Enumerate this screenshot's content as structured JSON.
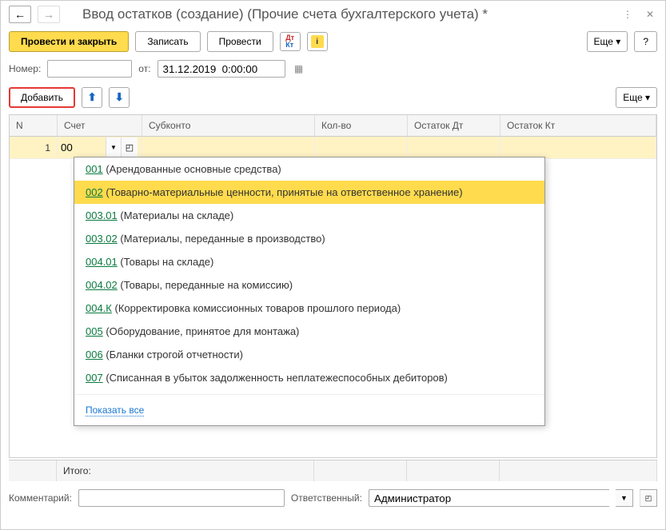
{
  "title": "Ввод остатков (создание) (Прочие счета бухгалтерского учета) *",
  "toolbar": {
    "post_close": "Провести и закрыть",
    "write": "Записать",
    "post": "Провести",
    "more": "Еще",
    "help": "?"
  },
  "form": {
    "number_label": "Номер:",
    "number_value": "",
    "from_label": "от:",
    "date_value": "31.12.2019  0:00:00"
  },
  "actions": {
    "add": "Добавить",
    "more": "Еще"
  },
  "table": {
    "headers": {
      "n": "N",
      "account": "Счет",
      "subkonto": "Субконто",
      "qty": "Кол-во",
      "balance_dt": "Остаток Дт",
      "balance_kt": "Остаток Кт"
    },
    "rows": [
      {
        "n": "1",
        "account": "00"
      }
    ],
    "total_label": "Итого:"
  },
  "dropdown": {
    "items": [
      {
        "code": "001",
        "text": " (Арендованные основные средства)",
        "selected": false
      },
      {
        "code": "002",
        "text": " (Товарно-материальные ценности, принятые на ответственное хранение)",
        "selected": true
      },
      {
        "code": "003.01",
        "text": " (Материалы на складе)",
        "selected": false
      },
      {
        "code": "003.02",
        "text": " (Материалы, переданные в производство)",
        "selected": false
      },
      {
        "code": "004.01",
        "text": " (Товары на складе)",
        "selected": false
      },
      {
        "code": "004.02",
        "text": " (Товары, переданные на комиссию)",
        "selected": false
      },
      {
        "code": "004.К",
        "text": " (Корректировка комиссионных товаров прошлого периода)",
        "selected": false
      },
      {
        "code": "005",
        "text": " (Оборудование, принятое для монтажа)",
        "selected": false
      },
      {
        "code": "006",
        "text": " (Бланки строгой отчетности)",
        "selected": false
      },
      {
        "code": "007",
        "text": " (Списанная в убыток задолженность неплатежеспособных дебиторов)",
        "selected": false
      }
    ],
    "show_all": "Показать все"
  },
  "bottom": {
    "comment_label": "Комментарий:",
    "comment_value": "",
    "responsible_label": "Ответственный:",
    "responsible_value": "Администратор"
  }
}
